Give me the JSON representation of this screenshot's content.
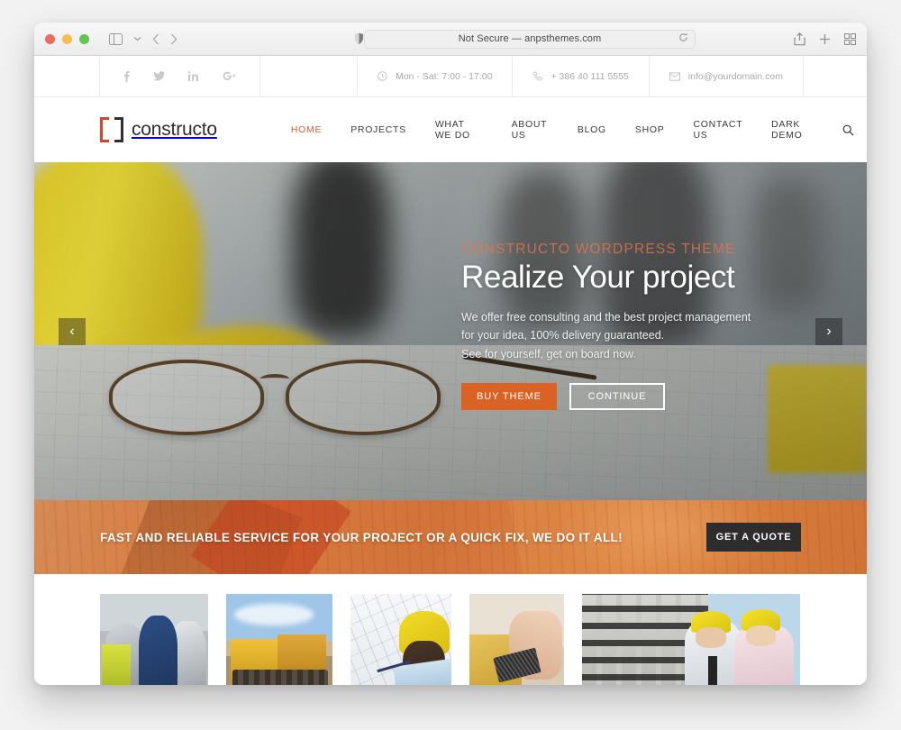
{
  "browser": {
    "address": "Not Secure — anpsthemes.com",
    "icons": {
      "sidebar": "sidebar-icon",
      "chevron": "chevron-down-icon",
      "back": "back-arrow-icon",
      "forward": "forward-arrow-icon",
      "shield": "privacy-shield-icon",
      "reload": "reload-icon",
      "share": "share-icon",
      "newtab": "new-tab-icon",
      "tabs": "tab-overview-icon"
    }
  },
  "topbar": {
    "social": [
      {
        "name": "facebook",
        "glyph": "f"
      },
      {
        "name": "twitter",
        "glyph": "ᵗ"
      },
      {
        "name": "linkedin",
        "glyph": "in"
      },
      {
        "name": "googleplus",
        "glyph": "G+"
      }
    ],
    "hours": "Mon - Sat: 7:00 - 17:00",
    "phone": "+ 386 40 111 5555",
    "email": "info@yourdomain.com"
  },
  "header": {
    "logo_text": "constructo",
    "nav": [
      {
        "label": "HOME",
        "active": true
      },
      {
        "label": "PROJECTS",
        "active": false
      },
      {
        "label": "WHAT WE DO",
        "active": false
      },
      {
        "label": "ABOUT US",
        "active": false
      },
      {
        "label": "BLOG",
        "active": false
      },
      {
        "label": "SHOP",
        "active": false
      },
      {
        "label": "CONTACT US",
        "active": false
      },
      {
        "label": "DARK DEMO",
        "active": false
      }
    ]
  },
  "hero": {
    "subtitle": "CONSTRUCTO WORDPRESS THEME",
    "title": "Realize Your project",
    "description_line1": "We offer free consulting and the best project management",
    "description_line2": "for your idea, 100% delivery guaranteed.",
    "description_line3": "See for yourself, get on board now.",
    "primary_button": "BUY THEME",
    "secondary_button": "CONTINUE",
    "prev_arrow": "‹",
    "next_arrow": "›"
  },
  "cta": {
    "text": "FAST AND RELIABLE SERVICE FOR YOUR PROJECT OR A QUICK FIX, WE DO IT ALL!",
    "button": "GET A QUOTE"
  },
  "thumbnails": [
    {
      "name": "workers-with-hardhats"
    },
    {
      "name": "bulldozers"
    },
    {
      "name": "architect-drawing-blueprint"
    },
    {
      "name": "hand-tool-on-wood"
    },
    {
      "name": "engineers-in-front-of-building"
    }
  ],
  "colors": {
    "accent": "#da6224",
    "logo_bracket": "#d1472a",
    "nav_active": "#d1603a",
    "cta_button": "#2d2d2d"
  }
}
